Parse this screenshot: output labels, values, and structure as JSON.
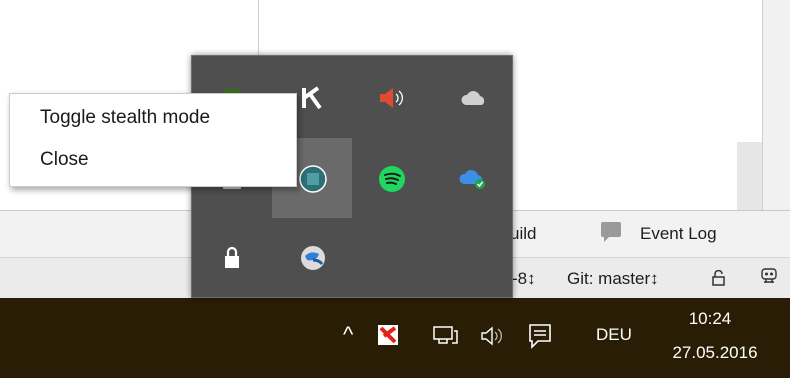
{
  "ide": {
    "build_label": "uild",
    "event_log_label": "Event Log",
    "encoding_label": "-8↕",
    "git_label": "Git: master↕"
  },
  "context_menu": {
    "items": [
      {
        "label": "Toggle stealth mode"
      },
      {
        "label": "Close"
      }
    ]
  },
  "tray_flyout": {
    "icons": [
      "app-green-icon",
      "k-app-icon",
      "volume-muted-icon",
      "onedrive-icon",
      "clipboard-icon",
      "mail-app-icon",
      "spotify-icon",
      "onedrive-synced-icon",
      "lock-icon",
      "globe-app-icon"
    ]
  },
  "taskbar": {
    "chevron": "^",
    "language": "DEU",
    "time": "10:24",
    "date": "27.05.2016"
  },
  "colors": {
    "taskbar_bg": "#2a1d05",
    "flyout_bg": "#4f4f4f",
    "spotify_green": "#1ed760",
    "kaspersky_red": "#e2231a"
  }
}
